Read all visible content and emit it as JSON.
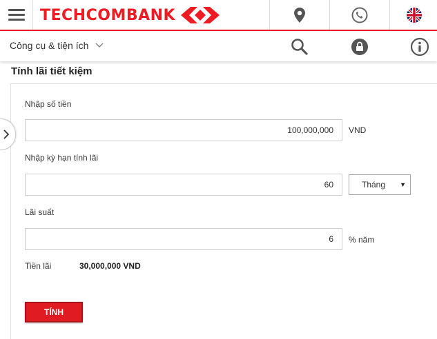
{
  "header": {
    "brand": "TECHCOMBANK",
    "icons": [
      "menu-icon",
      "map-pin-icon",
      "phone-icon",
      "uk-flag-icon"
    ],
    "accent_color": "#ed1c24"
  },
  "subbar": {
    "tools_label": "Công cụ & tiện ích",
    "icons": [
      "search-icon",
      "lock-icon",
      "info-icon"
    ]
  },
  "page": {
    "title": "Tính lãi tiết kiệm"
  },
  "form": {
    "amount_label": "Nhập số tiền",
    "amount_value": "100,000,000",
    "amount_unit": "VND",
    "term_label": "Nhập kỳ hạn tính lãi",
    "term_value": "60",
    "term_unit_selected": "Tháng",
    "rate_label": "Lãi suất",
    "rate_value": "6",
    "rate_unit": "% năm",
    "interest_label": "Tiền lãi",
    "interest_value": "30,000,000 VND",
    "submit_label": "TÍNH"
  }
}
